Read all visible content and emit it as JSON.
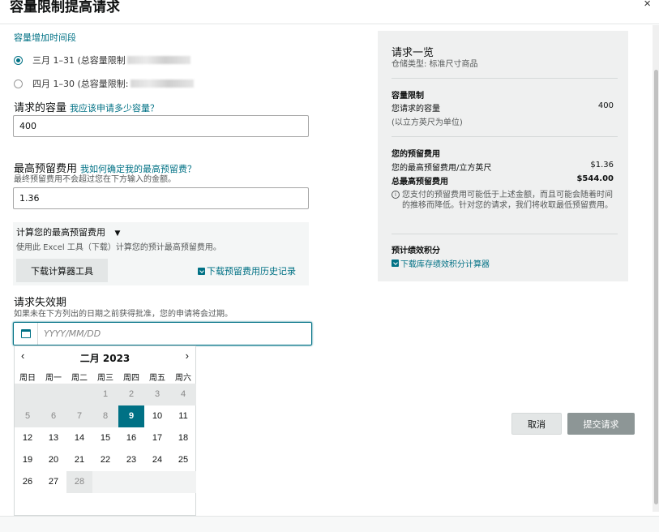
{
  "dialog": {
    "title": "容量限制提高请求",
    "close": "×"
  },
  "period": {
    "label": "容量增加时间段",
    "options": [
      {
        "label": "三月 1–31 (总容量限制",
        "selected": true
      },
      {
        "label": "四月 1–30 (总容量限制:",
        "selected": false
      }
    ]
  },
  "capacity": {
    "label": "请求的容量",
    "help": "我应该申请多少容量？",
    "value": "400"
  },
  "fee": {
    "label": "最高预留费用",
    "help": "我如何确定我的最高预留费？",
    "note": "最终预留费用不会超过您在下方输入的金额。",
    "value": "1.36"
  },
  "calculator": {
    "title": "计算您的最高预留费用",
    "toggle": "▼",
    "desc": "使用此 Excel 工具（下载）计算您的预计最高预留费用。",
    "download_btn": "下载计算器工具",
    "history_link": "下载预留费用历史记录"
  },
  "expiry": {
    "label": "请求失效期",
    "note": "如果未在下方列出的日期之前获得批准，您的申请将会过期。",
    "placeholder": "YYYY/MM/DD"
  },
  "calendar": {
    "prev": "‹",
    "next": "›",
    "month": "二月 2023",
    "weekdays": [
      "周日",
      "周一",
      "周二",
      "周三",
      "周四",
      "周五",
      "周六"
    ],
    "selected_day": "9"
  },
  "summary": {
    "title": "请求一览",
    "storage_type": "仓储类型: 标准尺寸商品",
    "capacity_heading": "容量限制",
    "requested_label": "您请求的容量",
    "requested_value": "400",
    "unit_note": "(以立方英尺为单位)",
    "fee_heading": "您的预留费用",
    "max_fee_label": "您的最高预留费用/立方英尺",
    "max_fee_value": "$1.36",
    "total_label": "总最高预留费用",
    "total_value": "$544.00",
    "note": "您支付的预留费用可能低于上述金额，而且可能会随着时间的推移而降低。针对您的请求，我们将收取最低预留费用。",
    "points_heading": "预计绩效积分",
    "points_link": "下载库存绩效积分计算器"
  },
  "buttons": {
    "cancel": "取消",
    "submit": "提交请求"
  },
  "colors": {
    "accent": "#007185",
    "submit_disabled": "#8d9696"
  }
}
